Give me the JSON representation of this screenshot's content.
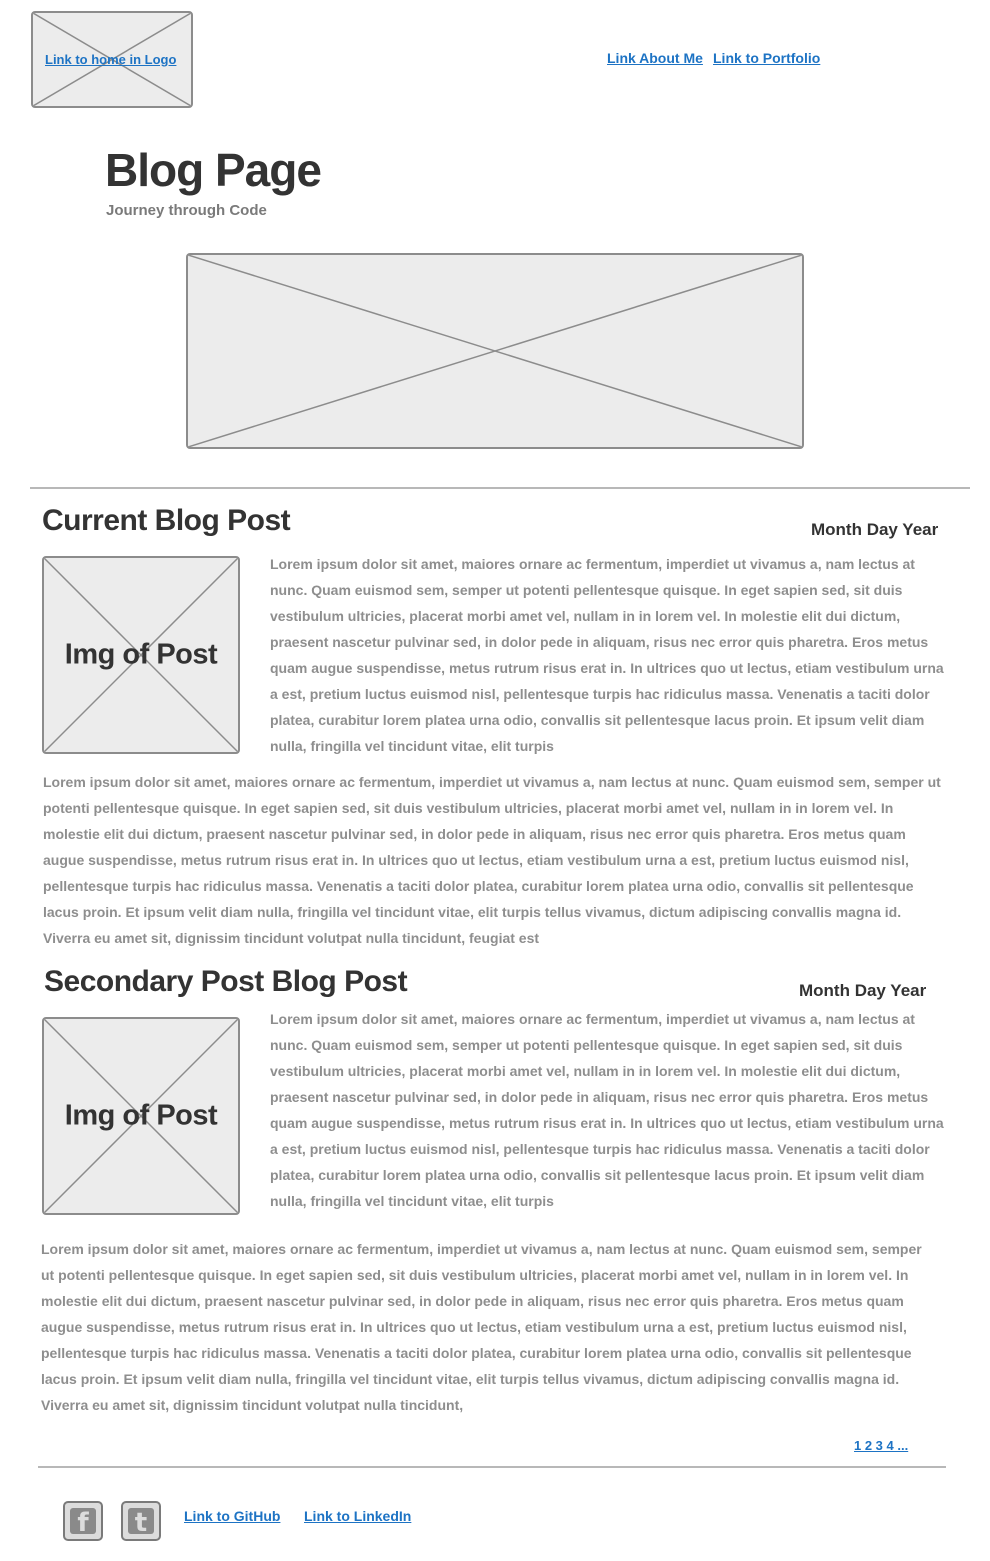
{
  "header": {
    "logo_link": "Link to home in Logo",
    "nav": [
      "Link About Me",
      "Link to Portfolio"
    ]
  },
  "hero": {
    "title": "Blog Page",
    "subtitle": "Journey through Code"
  },
  "posts": [
    {
      "title": "Current Blog Post",
      "date": "Month Day Year",
      "image_label": "Img of Post",
      "intro": "Lorem ipsum dolor sit amet, maiores ornare ac fermentum, imperdiet ut vivamus a, nam lectus at nunc. Quam euismod sem, semper ut potenti pellentesque quisque. In eget sapien sed, sit duis vestibulum ultricies, placerat morbi amet vel, nullam in in lorem vel. In molestie elit dui dictum, praesent nascetur pulvinar sed, in dolor pede in aliquam, risus nec error quis pharetra. Eros metus quam augue suspendisse, metus rutrum risus erat in.  In ultrices quo ut lectus, etiam vestibulum urna a est, pretium luctus euismod nisl, pellentesque turpis hac ridiculus massa. Venenatis a taciti dolor platea, curabitur lorem platea urna odio, convallis sit pellentesque lacus proin. Et ipsum velit diam nulla, fringilla vel tincidunt vitae, elit turpis",
      "body": "Lorem ipsum dolor sit amet, maiores ornare ac fermentum, imperdiet ut vivamus a, nam lectus at nunc. Quam euismod sem, semper ut potenti pellentesque quisque. In eget sapien sed, sit duis vestibulum ultricies, placerat morbi amet vel, nullam in in lorem vel. In molestie elit dui dictum, praesent nascetur pulvinar sed, in dolor pede in aliquam, risus nec error quis pharetra. Eros metus quam augue suspendisse, metus rutrum risus erat in.  In ultrices quo ut lectus, etiam vestibulum urna a est, pretium luctus euismod nisl, pellentesque turpis hac ridiculus massa. Venenatis a taciti dolor platea, curabitur lorem platea urna odio, convallis sit pellentesque lacus proin. Et ipsum velit diam nulla, fringilla vel tincidunt vitae, elit turpis tellus vivamus, dictum adipiscing convallis magna id. Viverra eu amet sit, dignissim tincidunt volutpat nulla tincidunt, feugiat est"
    },
    {
      "title": "Secondary Post Blog Post",
      "date": "Month Day Year",
      "image_label": "Img of Post",
      "intro": "Lorem ipsum dolor sit amet, maiores ornare ac fermentum, imperdiet ut vivamus a, nam lectus at nunc. Quam euismod sem, semper ut potenti pellentesque quisque. In eget sapien sed, sit duis vestibulum ultricies, placerat morbi amet vel, nullam in in lorem vel. In molestie elit dui dictum, praesent nascetur pulvinar sed, in dolor pede in aliquam, risus nec error quis pharetra. Eros metus quam augue suspendisse, metus rutrum risus erat in.  In ultrices quo ut lectus, etiam vestibulum urna a est, pretium luctus euismod nisl, pellentesque turpis hac ridiculus massa. Venenatis a taciti dolor platea, curabitur lorem platea urna odio, convallis sit pellentesque lacus proin. Et ipsum velit diam nulla, fringilla vel tincidunt vitae, elit turpis",
      "body": "Lorem ipsum dolor sit amet, maiores ornare ac fermentum, imperdiet ut vivamus a, nam lectus at nunc. Quam euismod sem, semper ut potenti pellentesque quisque. In eget sapien sed, sit duis vestibulum ultricies, placerat morbi amet vel, nullam in in lorem vel. In molestie elit dui dictum, praesent nascetur pulvinar sed, in dolor pede in aliquam, risus nec error quis pharetra. Eros metus quam augue suspendisse, metus rutrum risus erat in.  In ultrices quo ut lectus, etiam vestibulum urna a est, pretium luctus euismod nisl, pellentesque turpis hac ridiculus massa. Venenatis a taciti dolor platea, curabitur lorem platea urna odio, convallis sit pellentesque lacus proin. Et ipsum velit diam nulla, fringilla vel tincidunt vitae, elit turpis tellus vivamus, dictum adipiscing convallis magna id. Viverra eu amet sit, dignissim tincidunt volutpat nulla tincidunt,"
    }
  ],
  "pagination": "1 2 3 4 ...",
  "footer": {
    "social_icons": [
      "facebook-icon",
      "twitter-icon"
    ],
    "links": [
      "Link to GitHub",
      "Link to LinkedIn"
    ]
  },
  "colors": {
    "link": "#1d73c4",
    "placeholder_bg": "#ececec",
    "placeholder_border": "#8c8c8c",
    "body_text": "#8e8e8e",
    "heading": "#333333"
  }
}
